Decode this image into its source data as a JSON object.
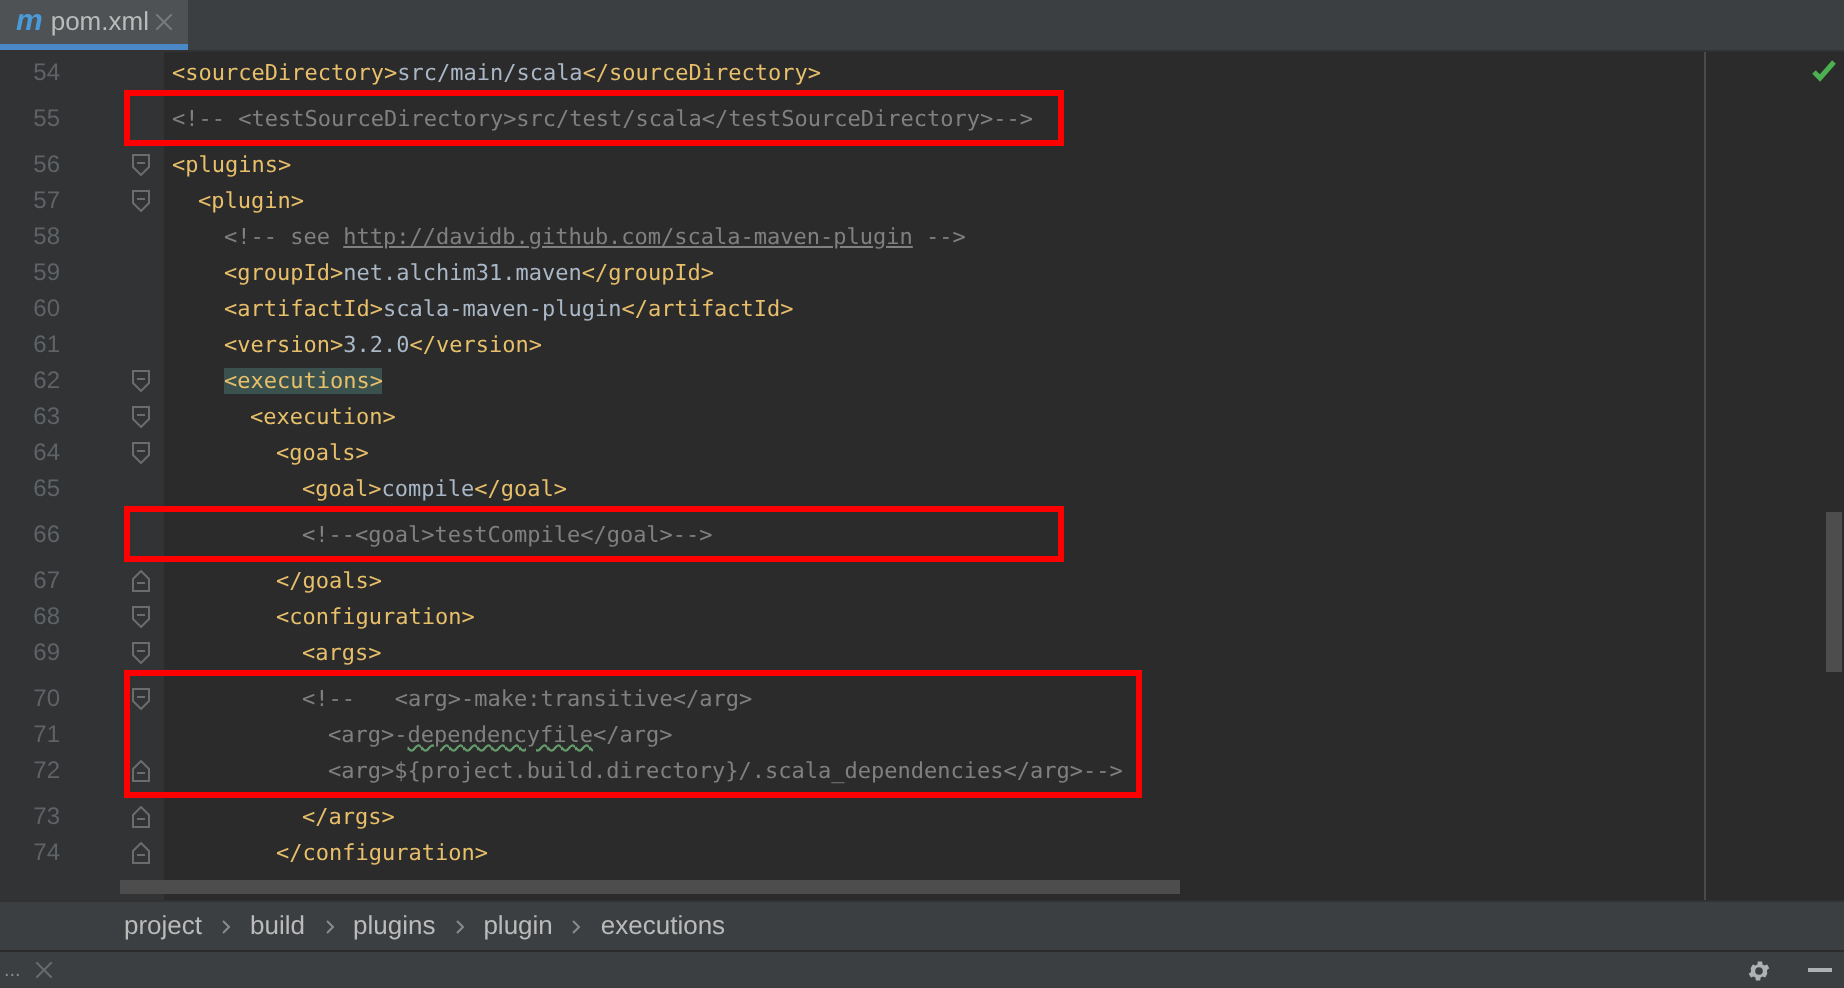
{
  "tabs": [
    {
      "logo": "m",
      "label": "pom.xml",
      "selected": true
    }
  ],
  "lines": [
    {
      "number": "54",
      "fold_start": false,
      "fold_end": false,
      "boxed": false,
      "segments": [
        {
          "kind": "tag",
          "text": "<sourceDirectory>"
        },
        {
          "kind": "text",
          "text": "src/main/scala"
        },
        {
          "kind": "tag",
          "text": "</sourceDirectory>"
        }
      ]
    },
    {
      "number": "55",
      "fold_start": false,
      "fold_end": false,
      "boxed": true,
      "segments": [
        {
          "kind": "comment",
          "text": "<!-- <testSourceDirectory>src/test/scala</testSourceDirectory>-->"
        }
      ]
    },
    {
      "number": "56",
      "fold_start": true,
      "fold_end": false,
      "boxed": false,
      "segments": [
        {
          "kind": "tag",
          "text": "<plugins>"
        }
      ],
      "children": [
        {
          "number": "57",
          "fold_start": true,
          "fold_end": false,
          "boxed": false,
          "segments": [
            {
              "kind": "tag",
              "text": "<plugin>"
            }
          ],
          "children": [
            {
              "number": "58",
              "fold_start": false,
              "fold_end": false,
              "boxed": false,
              "segments": [
                {
                  "kind": "comment",
                  "text": "<!-- see "
                },
                {
                  "kind": "url",
                  "text": "http://davidb.github.com/scala-maven-plugin"
                },
                {
                  "kind": "comment",
                  "text": " -->"
                }
              ]
            },
            {
              "number": "59",
              "fold_start": false,
              "fold_end": false,
              "boxed": false,
              "segments": [
                {
                  "kind": "tag",
                  "text": "<groupId>"
                },
                {
                  "kind": "text",
                  "text": "net.alchim31.maven"
                },
                {
                  "kind": "tag",
                  "text": "</groupId>"
                }
              ]
            },
            {
              "number": "60",
              "fold_start": false,
              "fold_end": false,
              "boxed": false,
              "segments": [
                {
                  "kind": "tag",
                  "text": "<artifactId>"
                },
                {
                  "kind": "text",
                  "text": "scala-maven-plugin"
                },
                {
                  "kind": "tag",
                  "text": "</artifactId>"
                }
              ]
            },
            {
              "number": "61",
              "fold_start": false,
              "fold_end": false,
              "boxed": false,
              "segments": [
                {
                  "kind": "tag",
                  "text": "<version>"
                },
                {
                  "kind": "text",
                  "text": "3.2.0"
                },
                {
                  "kind": "tag",
                  "text": "</version>"
                }
              ]
            },
            {
              "number": "62",
              "fold_start": true,
              "fold_end": false,
              "boxed": false,
              "segments": [
                {
                  "kind": "match",
                  "text": "<executions>"
                }
              ],
              "children": [
                {
                  "number": "63",
                  "fold_start": true,
                  "fold_end": false,
                  "boxed": false,
                  "segments": [
                    {
                      "kind": "tag",
                      "text": "<execution>"
                    }
                  ],
                  "children": [
                    {
                      "number": "64",
                      "fold_start": true,
                      "fold_end": false,
                      "boxed": false,
                      "segments": [
                        {
                          "kind": "tag",
                          "text": "<goals>"
                        }
                      ],
                      "children": [
                        {
                          "number": "65",
                          "fold_start": false,
                          "fold_end": false,
                          "boxed": false,
                          "segments": [
                            {
                              "kind": "tag",
                              "text": "<goal>"
                            },
                            {
                              "kind": "text",
                              "text": "compile"
                            },
                            {
                              "kind": "tag",
                              "text": "</goal>"
                            }
                          ]
                        },
                        {
                          "number": "66",
                          "fold_start": false,
                          "fold_end": false,
                          "boxed": true,
                          "segments": [
                            {
                              "kind": "comment",
                              "text": "<!--<goal>testCompile</goal>-->"
                            }
                          ]
                        }
                      ]
                    },
                    {
                      "number": "67",
                      "fold_start": false,
                      "fold_end": true,
                      "boxed": false,
                      "segments": [
                        {
                          "kind": "tag",
                          "text": "</goals>"
                        }
                      ]
                    },
                    {
                      "number": "68",
                      "fold_start": true,
                      "fold_end": false,
                      "boxed": false,
                      "segments": [
                        {
                          "kind": "tag",
                          "text": "<configuration>"
                        }
                      ],
                      "children": [
                        {
                          "number": "69",
                          "fold_start": true,
                          "fold_end": false,
                          "boxed": false,
                          "segments": [
                            {
                              "kind": "tag",
                              "text": "<args>"
                            }
                          ]
                        },
                        {
                          "number": "70",
                          "fold_start": true,
                          "fold_end": false,
                          "boxed": true,
                          "segments": [
                            {
                              "kind": "comment",
                              "text": "<!--   <arg>-make:transitive</arg>"
                            }
                          ],
                          "children": [
                            {
                              "number": "71",
                              "fold_start": false,
                              "fold_end": false,
                              "boxed": true,
                              "segments": [
                                {
                                  "kind": "comment",
                                  "text": "<arg>-"
                                },
                                {
                                  "kind": "typo",
                                  "text": "dependencyfile"
                                },
                                {
                                  "kind": "comment",
                                  "text": "</arg>"
                                }
                              ]
                            },
                            {
                              "number": "72",
                              "fold_start": false,
                              "fold_end": true,
                              "boxed": true,
                              "segments": [
                                {
                                  "kind": "comment",
                                  "text": "<arg>${project.build.directory}/.scala_dependencies</arg>-->"
                                }
                              ]
                            }
                          ]
                        },
                        {
                          "number": "73",
                          "fold_start": false,
                          "fold_end": true,
                          "boxed": false,
                          "segments": [
                            {
                              "kind": "tag",
                              "text": "</args>"
                            }
                          ]
                        }
                      ]
                    },
                    {
                      "number": "74",
                      "fold_start": false,
                      "fold_end": true,
                      "boxed": false,
                      "segments": [
                        {
                          "kind": "tag",
                          "text": "</configuration>"
                        }
                      ]
                    }
                  ]
                }
              ]
            }
          ]
        }
      ]
    }
  ],
  "breadcrumbs": [
    "project",
    "build",
    "plugins",
    "plugin",
    "executions"
  ],
  "bottom_bar": {
    "label": "..."
  }
}
